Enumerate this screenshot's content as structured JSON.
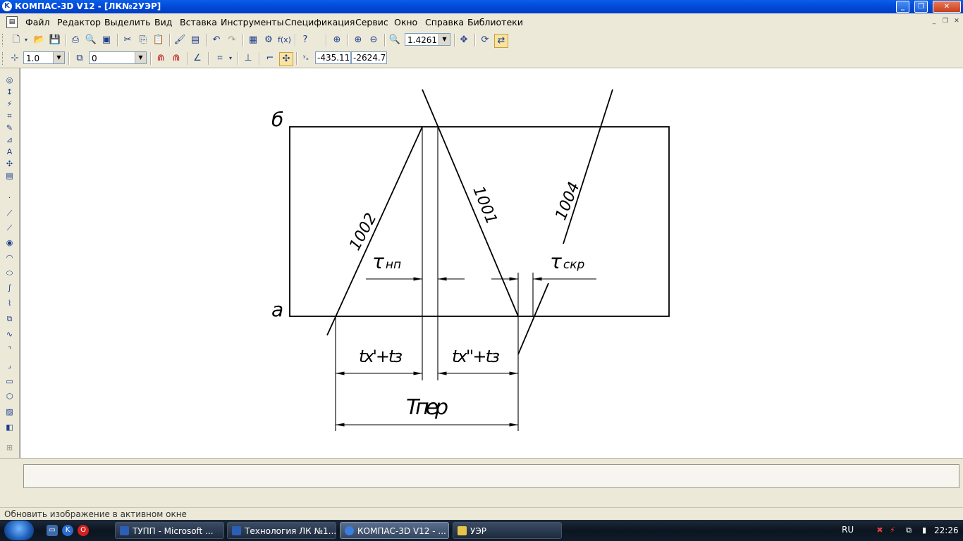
{
  "window": {
    "title": "КОМПАС-3D V12 - [ЛК№2УЭР]"
  },
  "menu": [
    "Файл",
    "Редактор",
    "Выделить",
    "Вид",
    "Вставка",
    "Инструменты",
    "Спецификация",
    "Сервис",
    "Окно",
    "Справка",
    "Библиотеки"
  ],
  "toolbar": {
    "zoom_value": "1.4261",
    "style_value": "1.0",
    "layer_value": "0",
    "coord_x": "-435.11",
    "coord_y": "-2624.7"
  },
  "drawing": {
    "label_b": "б",
    "label_a": "а",
    "slope_1002": "1002",
    "slope_1001": "1001",
    "slope_1004": "1004",
    "tau_np_symbol": "τ",
    "tau_np_sub": "нп",
    "tau_skr_symbol": "τ",
    "tau_skr_sub": "скр",
    "dim_left_label": "tx'+tз",
    "dim_right_label": "tx''+tз",
    "dim_total_label": "Tпер"
  },
  "status": {
    "text": "Обновить изображение в активном окне"
  },
  "taskbar": {
    "items": [
      "ТУПП - Microsoft ...",
      "Технология ЛК №1...",
      "КОМПАС-3D V12 - ...",
      "УЭР"
    ],
    "language": "RU",
    "clock": "22:26"
  },
  "colors": {
    "titlebar": "#0046d5",
    "canvas": "#ffffff",
    "chrome": "#ece9d8",
    "taskbar": "#101c2a"
  }
}
